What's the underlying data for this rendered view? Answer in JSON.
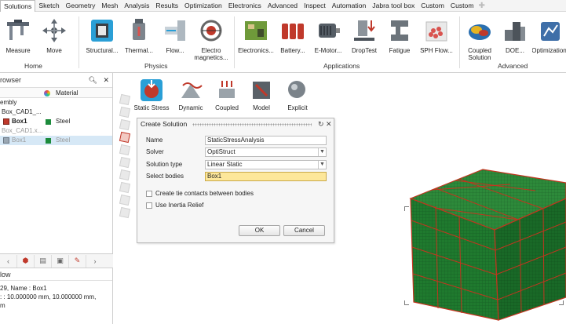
{
  "menubar": {
    "items": [
      "Solutions",
      "Sketch",
      "Geometry",
      "Mesh",
      "Analysis",
      "Results",
      "Optimization",
      "Electronics",
      "Advanced",
      "Inspect",
      "Automation",
      "Jabra tool box",
      "Custom",
      "Custom"
    ],
    "active": "Solutions",
    "plus_icon": "plus-icon"
  },
  "ribbon": {
    "home_buttons": [
      {
        "label": "Measure",
        "icon": "caliper-icon"
      },
      {
        "label": "Move",
        "icon": "move-arrows-icon"
      }
    ],
    "physics_buttons": [
      {
        "label": "Structural...",
        "icon": "structural-icon"
      },
      {
        "label": "Thermal...",
        "icon": "thermal-icon"
      },
      {
        "label": "Flow...",
        "icon": "flow-icon"
      },
      {
        "label": "Electro\nmagnetics...",
        "label1": "Electro",
        "label2": "magnetics...",
        "icon": "electromagnetics-icon"
      }
    ],
    "application_buttons": [
      {
        "label": "Electronics...",
        "icon": "pcb-icon"
      },
      {
        "label": "Battery...",
        "icon": "battery-icon"
      },
      {
        "label": "E-Motor...",
        "icon": "motor-icon"
      },
      {
        "label": "DropTest",
        "icon": "drop-test-icon"
      },
      {
        "label": "Fatigue",
        "icon": "fatigue-icon"
      },
      {
        "label": "SPH Flow...",
        "icon": "sph-icon"
      }
    ],
    "advanced_buttons": [
      {
        "label1": "Coupled",
        "label2": "Solution",
        "icon": "coupled-solution-icon"
      },
      {
        "label": "DOE...",
        "icon": "doe-icon"
      },
      {
        "label": "Optimization",
        "icon": "optimization-icon"
      }
    ],
    "groups": {
      "home": "Home",
      "physics": "Physics",
      "applications": "Applications",
      "advanced": "Advanced"
    }
  },
  "browser": {
    "title": "rowser",
    "columns": {
      "material": "Material"
    },
    "rows": [
      {
        "name": "embly",
        "indent": 0
      },
      {
        "name": "Box_CAD1_...",
        "indent": 1
      },
      {
        "name": "Box1",
        "bold": true,
        "material": "Steel",
        "indent": 1,
        "icon": "box-part-icon"
      },
      {
        "name": "Box_CAD1.x...",
        "indent": 1,
        "gray": true
      },
      {
        "name": "Box1",
        "material": "Steel",
        "indent": 1,
        "gray": true,
        "selected": true,
        "icon": "box-part-icon"
      }
    ]
  },
  "props": {
    "title": "low",
    "lines": [
      "29, Name : Box1",
      ": : 10.000000 mm, 10.000000 mm,",
      "m"
    ]
  },
  "subribbon": {
    "buttons": [
      {
        "label": "Static Stress",
        "icon": "static-stress-icon"
      },
      {
        "label": "Dynamic",
        "icon": "dynamic-icon"
      },
      {
        "label": "Coupled",
        "icon": "coupled-icon"
      },
      {
        "label": "Model",
        "icon": "model-icon"
      },
      {
        "label": "Explicit",
        "icon": "explicit-icon"
      }
    ]
  },
  "dialog": {
    "title": "Create Solution",
    "name_label": "Name",
    "name_value": "StaticStressAnalysis",
    "solver_label": "Solver",
    "solver_value": "OptiStruct",
    "solution_type_label": "Solution type",
    "solution_type_value": "Linear Static",
    "select_bodies_label": "Select bodies",
    "select_bodies_value": "Box1",
    "tie_contacts_label": "Create tie contacts between bodies",
    "inertia_relief_label": "Use Inertia Relief",
    "ok_label": "OK",
    "cancel_label": "Cancel"
  },
  "colors": {
    "mesh_green": "#1f7a2e",
    "mesh_red": "#c2351f",
    "highlight_yellow": "#fde79a",
    "steel_chip": "#1c8b3c",
    "selection_blue": "#d6e8f6"
  }
}
